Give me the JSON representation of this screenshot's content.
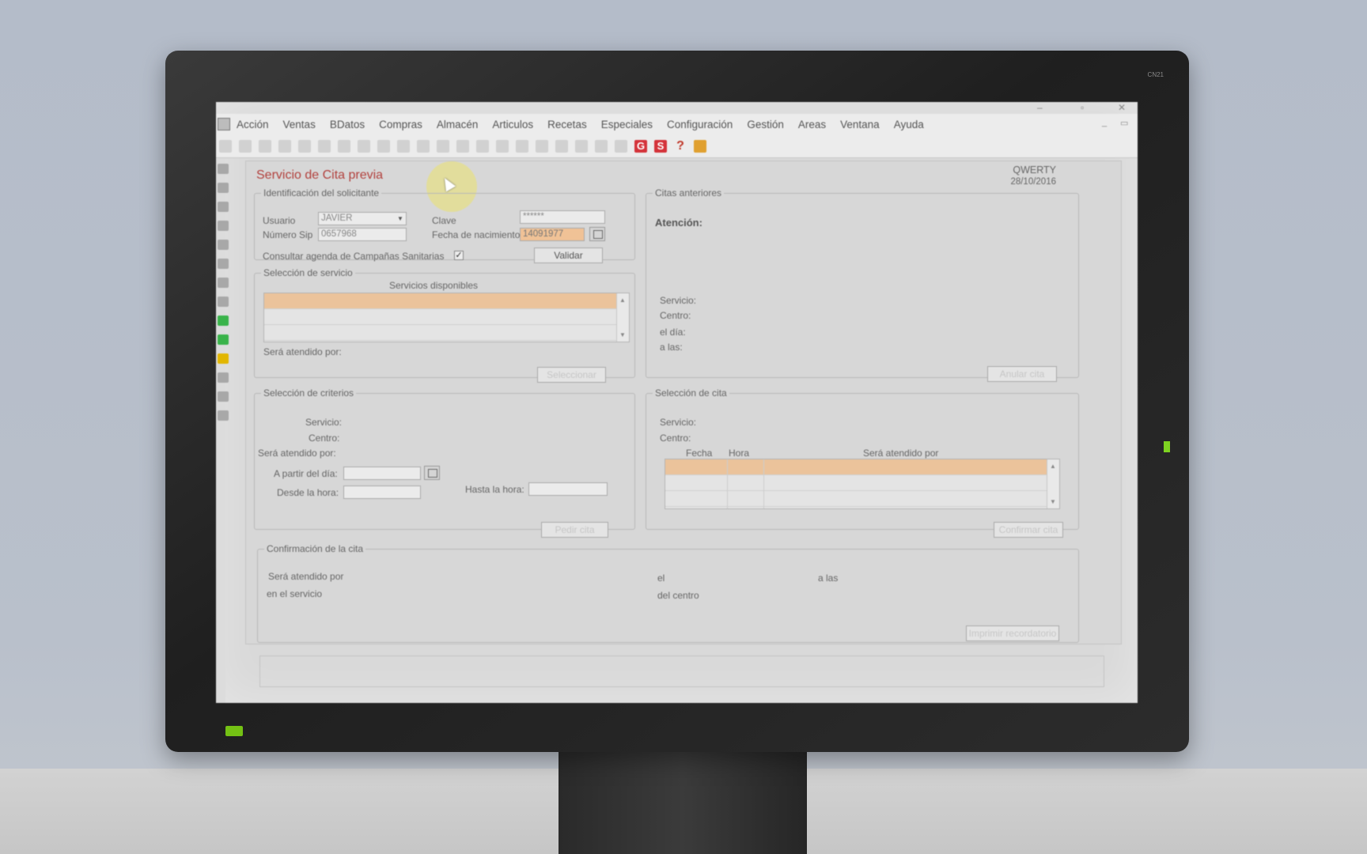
{
  "monitor": {
    "bezel_label": "CN21"
  },
  "menu": {
    "items": [
      "Acción",
      "Ventas",
      "BDatos",
      "Compras",
      "Almacén",
      "Articulos",
      "Recetas",
      "Especiales",
      "Configuración",
      "Gestión",
      "Areas",
      "Ventana",
      "Ayuda"
    ]
  },
  "toolbar": {
    "g_label": "G",
    "s_label": "S",
    "help_label": "?"
  },
  "form": {
    "title": "Servicio de Cita previa",
    "user_code": "QWERTY",
    "date": "28/10/2016"
  },
  "identificacion": {
    "legend": "Identificación del solicitante",
    "usuario_label": "Usuario",
    "usuario_value": "JAVIER",
    "clave_label": "Clave",
    "clave_value": "******",
    "sip_label": "Número Sip",
    "sip_value": "0657968",
    "nacimiento_label": "Fecha de nacimiento",
    "nacimiento_value": "14091977",
    "campanas_label": "Consultar agenda de Campañas Sanitarias",
    "campanas_checked": true,
    "validar_label": "Validar"
  },
  "seleccion_servicio": {
    "legend": "Selección de servicio",
    "list_header": "Servicios disponibles",
    "atendido_label": "Será atendido por:",
    "seleccionar_label": "Seleccionar"
  },
  "citas_anteriores": {
    "legend": "Citas anteriores",
    "atencion_label": "Atención:",
    "servicio_label": "Servicio:",
    "centro_label": "Centro:",
    "dia_label": "el día:",
    "hora_label": "a las:",
    "anular_label": "Anular cita"
  },
  "seleccion_criterios": {
    "legend": "Selección de criterios",
    "servicio_label": "Servicio:",
    "centro_label": "Centro:",
    "atendido_label": "Será atendido por:",
    "apartir_label": "A partir del día:",
    "desde_label": "Desde la hora:",
    "hasta_label": "Hasta la hora:",
    "pedir_label": "Pedir cita"
  },
  "seleccion_cita": {
    "legend": "Selección de cita",
    "servicio_label": "Servicio:",
    "centro_label": "Centro:",
    "columns": [
      "Fecha",
      "Hora",
      "Será atendido por"
    ],
    "confirmar_label": "Confirmar cita"
  },
  "confirmacion": {
    "legend": "Confirmación de la cita",
    "atendido_label": "Será atendido por",
    "servicio_label": "en el servicio",
    "el_label": "el",
    "alas_label": "a las",
    "centro_label": "del centro",
    "imprimir_label": "Imprimir recordatorio"
  },
  "colors": {
    "title_red": "#b2413d",
    "selection": "#ebc39b",
    "highlight_field": "#f0c296"
  }
}
